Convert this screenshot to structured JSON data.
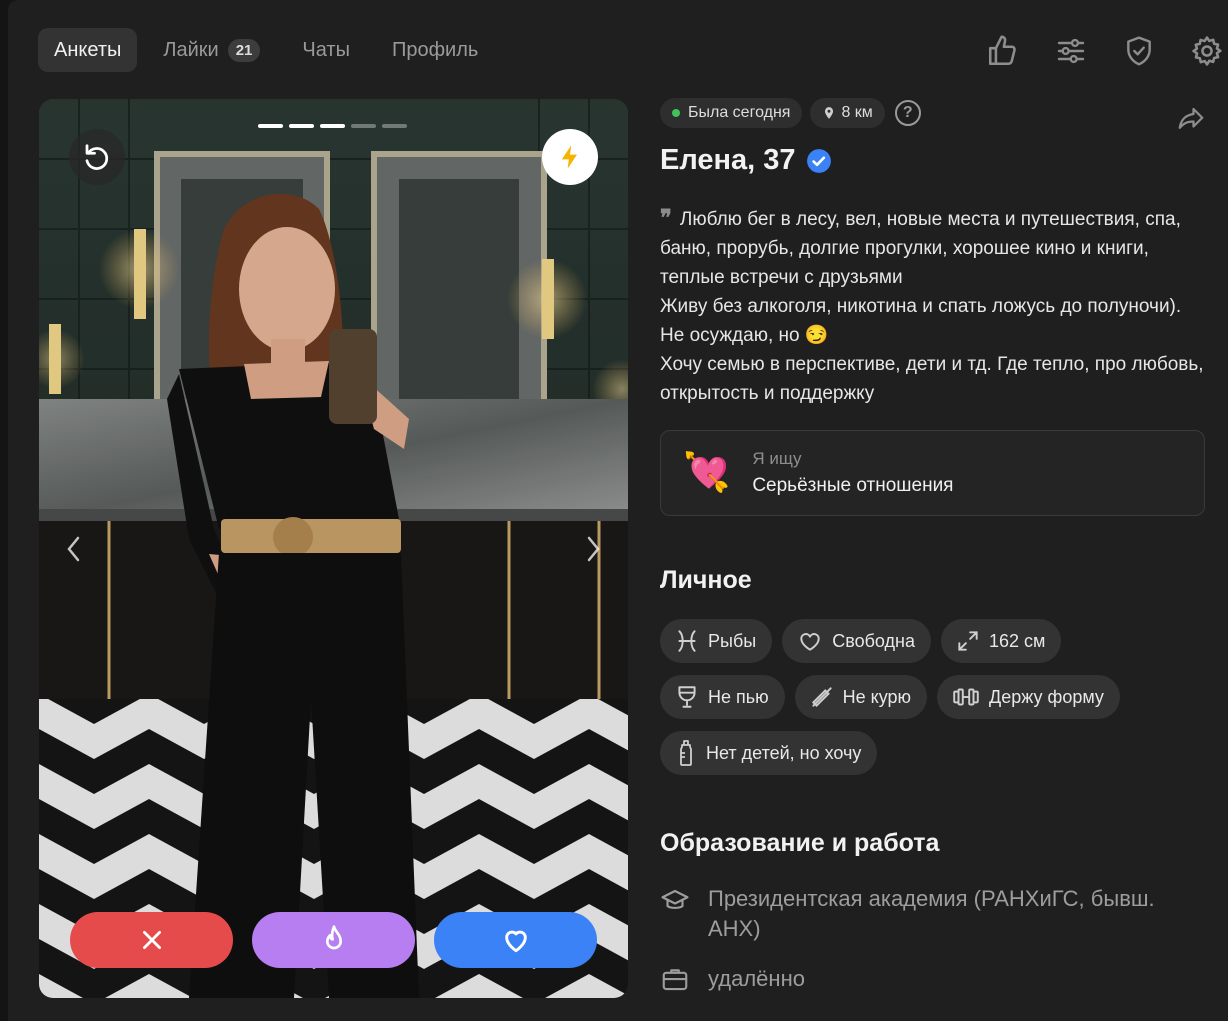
{
  "nav": {
    "tabs": [
      {
        "label": "Анкеты",
        "active": true
      },
      {
        "label": "Лайки",
        "badge": "21"
      },
      {
        "label": "Чаты"
      },
      {
        "label": "Профиль"
      }
    ],
    "icons": [
      "thumbs-up-icon",
      "sliders-icon",
      "shield-check-icon",
      "gear-icon"
    ]
  },
  "photo": {
    "slides_total": 5,
    "slide_active": 3,
    "undo_icon": "undo-icon",
    "boost_icon": "lightning-icon"
  },
  "actions": {
    "dislike_color": "#e54b4b",
    "superlike_color": "#b67ef0",
    "like_color": "#3b82f6"
  },
  "profile": {
    "status": "Была сегодня",
    "status_color": "#3fc45a",
    "distance": "8 км",
    "help": "?",
    "name": "Елена, 37",
    "verified_color": "#3b82f6",
    "bio_lines": [
      "Люблю бег в лесу, вел, новые места и путешествия, спа, баню, прорубь, долгие прогулки, хорошее кино и книги, теплые встречи с друзьями",
      "Живу без алкоголя, никотина и спать ложусь до полуночи). Не осуждаю, но 😏",
      "Хочу семью в перспективе, дети и тд. Где тепло, про любовь, открытость и поддержку"
    ],
    "quote_mark": "❞",
    "seeking": {
      "emoji": "💘",
      "label": "Я ищу",
      "value": "Серьёзные отношения"
    }
  },
  "personal": {
    "title": "Личное",
    "chips": [
      {
        "icon": "pisces-icon",
        "label": "Рыбы"
      },
      {
        "icon": "heart-outline-icon",
        "label": "Свободна"
      },
      {
        "icon": "expand-icon",
        "label": "162 см"
      },
      {
        "icon": "glass-icon",
        "label": "Не пью"
      },
      {
        "icon": "no-smoking-icon",
        "label": "Не курю"
      },
      {
        "icon": "dumbbell-icon",
        "label": "Держу форму"
      },
      {
        "icon": "baby-bottle-icon",
        "label": "Нет детей, но хочу"
      }
    ]
  },
  "education": {
    "title": "Образование и работа",
    "university": "Президентская академия (РАНХиГС, бывш. АНХ)",
    "work": "удалённо"
  }
}
